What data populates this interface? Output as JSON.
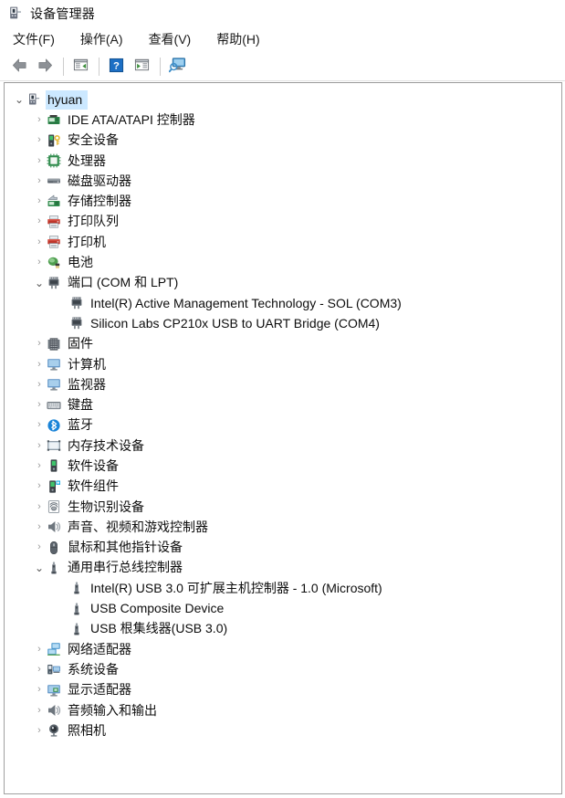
{
  "window": {
    "title": "设备管理器",
    "icon": "device-manager-icon"
  },
  "menubar": {
    "items": [
      {
        "label": "文件(F)",
        "name": "menu-file"
      },
      {
        "label": "操作(A)",
        "name": "menu-action"
      },
      {
        "label": "查看(V)",
        "name": "menu-view"
      },
      {
        "label": "帮助(H)",
        "name": "menu-help"
      }
    ]
  },
  "toolbar": {
    "buttons": [
      {
        "name": "back-button",
        "icon": "back-arrow-icon",
        "tooltip": "后退"
      },
      {
        "name": "forward-button",
        "icon": "forward-arrow-icon",
        "tooltip": "前进"
      },
      {
        "name": "properties-button",
        "icon": "properties-icon",
        "tooltip": "属性"
      },
      {
        "name": "help-button",
        "icon": "help-question-icon",
        "tooltip": "帮助"
      },
      {
        "name": "update-driver-button",
        "icon": "update-driver-icon",
        "tooltip": "更新驱动程序"
      },
      {
        "name": "scan-hardware-button",
        "icon": "scan-hardware-icon",
        "tooltip": "扫描检测硬件改动"
      }
    ]
  },
  "tree": {
    "nodes": [
      {
        "label": "hyuan",
        "level": 0,
        "state": "expanded",
        "icon": "computer-icon",
        "selected": true
      },
      {
        "label": "IDE ATA/ATAPI 控制器",
        "level": 1,
        "state": "collapsed",
        "icon": "ide-controller-icon",
        "selected": false
      },
      {
        "label": "安全设备",
        "level": 1,
        "state": "collapsed",
        "icon": "security-device-icon",
        "selected": false
      },
      {
        "label": "处理器",
        "level": 1,
        "state": "collapsed",
        "icon": "processor-icon",
        "selected": false
      },
      {
        "label": "磁盘驱动器",
        "level": 1,
        "state": "collapsed",
        "icon": "disk-drive-icon",
        "selected": false
      },
      {
        "label": "存储控制器",
        "level": 1,
        "state": "collapsed",
        "icon": "storage-controller-icon",
        "selected": false
      },
      {
        "label": "打印队列",
        "level": 1,
        "state": "collapsed",
        "icon": "print-queue-icon",
        "selected": false
      },
      {
        "label": "打印机",
        "level": 1,
        "state": "collapsed",
        "icon": "printer-icon",
        "selected": false
      },
      {
        "label": "电池",
        "level": 1,
        "state": "collapsed",
        "icon": "battery-icon",
        "selected": false
      },
      {
        "label": "端口 (COM 和 LPT)",
        "level": 1,
        "state": "expanded",
        "icon": "port-icon",
        "selected": false
      },
      {
        "label": "Intel(R) Active Management Technology - SOL (COM3)",
        "level": 2,
        "state": "leaf",
        "icon": "port-icon",
        "selected": false
      },
      {
        "label": "Silicon Labs CP210x USB to UART Bridge (COM4)",
        "level": 2,
        "state": "leaf",
        "icon": "port-icon",
        "selected": false
      },
      {
        "label": "固件",
        "level": 1,
        "state": "collapsed",
        "icon": "firmware-icon",
        "selected": false
      },
      {
        "label": "计算机",
        "level": 1,
        "state": "collapsed",
        "icon": "monitor-icon",
        "selected": false
      },
      {
        "label": "监视器",
        "level": 1,
        "state": "collapsed",
        "icon": "monitor-icon",
        "selected": false
      },
      {
        "label": "键盘",
        "level": 1,
        "state": "collapsed",
        "icon": "keyboard-icon",
        "selected": false
      },
      {
        "label": "蓝牙",
        "level": 1,
        "state": "collapsed",
        "icon": "bluetooth-icon",
        "selected": false
      },
      {
        "label": "内存技术设备",
        "level": 1,
        "state": "collapsed",
        "icon": "memory-device-icon",
        "selected": false
      },
      {
        "label": "软件设备",
        "level": 1,
        "state": "collapsed",
        "icon": "software-device-icon",
        "selected": false
      },
      {
        "label": "软件组件",
        "level": 1,
        "state": "collapsed",
        "icon": "software-component-icon",
        "selected": false
      },
      {
        "label": "生物识别设备",
        "level": 1,
        "state": "collapsed",
        "icon": "biometric-icon",
        "selected": false
      },
      {
        "label": "声音、视频和游戏控制器",
        "level": 1,
        "state": "collapsed",
        "icon": "speaker-icon",
        "selected": false
      },
      {
        "label": "鼠标和其他指针设备",
        "level": 1,
        "state": "collapsed",
        "icon": "mouse-icon",
        "selected": false
      },
      {
        "label": "通用串行总线控制器",
        "level": 1,
        "state": "expanded",
        "icon": "usb-icon",
        "selected": false
      },
      {
        "label": "Intel(R) USB 3.0 可扩展主机控制器 - 1.0 (Microsoft)",
        "level": 2,
        "state": "leaf",
        "icon": "usb-icon",
        "selected": false
      },
      {
        "label": "USB Composite Device",
        "level": 2,
        "state": "leaf",
        "icon": "usb-icon",
        "selected": false
      },
      {
        "label": "USB 根集线器(USB 3.0)",
        "level": 2,
        "state": "leaf",
        "icon": "usb-icon",
        "selected": false
      },
      {
        "label": "网络适配器",
        "level": 1,
        "state": "collapsed",
        "icon": "network-adapter-icon",
        "selected": false
      },
      {
        "label": "系统设备",
        "level": 1,
        "state": "collapsed",
        "icon": "system-device-icon",
        "selected": false
      },
      {
        "label": "显示适配器",
        "level": 1,
        "state": "collapsed",
        "icon": "display-adapter-icon",
        "selected": false
      },
      {
        "label": "音频输入和输出",
        "level": 1,
        "state": "collapsed",
        "icon": "audio-io-icon",
        "selected": false
      },
      {
        "label": "照相机",
        "level": 1,
        "state": "collapsed",
        "icon": "camera-icon",
        "selected": false
      }
    ],
    "glyphs": {
      "collapsed": "›",
      "expanded": "⌄"
    }
  },
  "colors": {
    "selection": "#cce8ff",
    "border": "#a0a0a0",
    "twisty": "#9a9a9a",
    "accent_blue": "#1a7fd4",
    "icon_green": "#2e9e4f",
    "icon_gray": "#5a5a5a"
  }
}
